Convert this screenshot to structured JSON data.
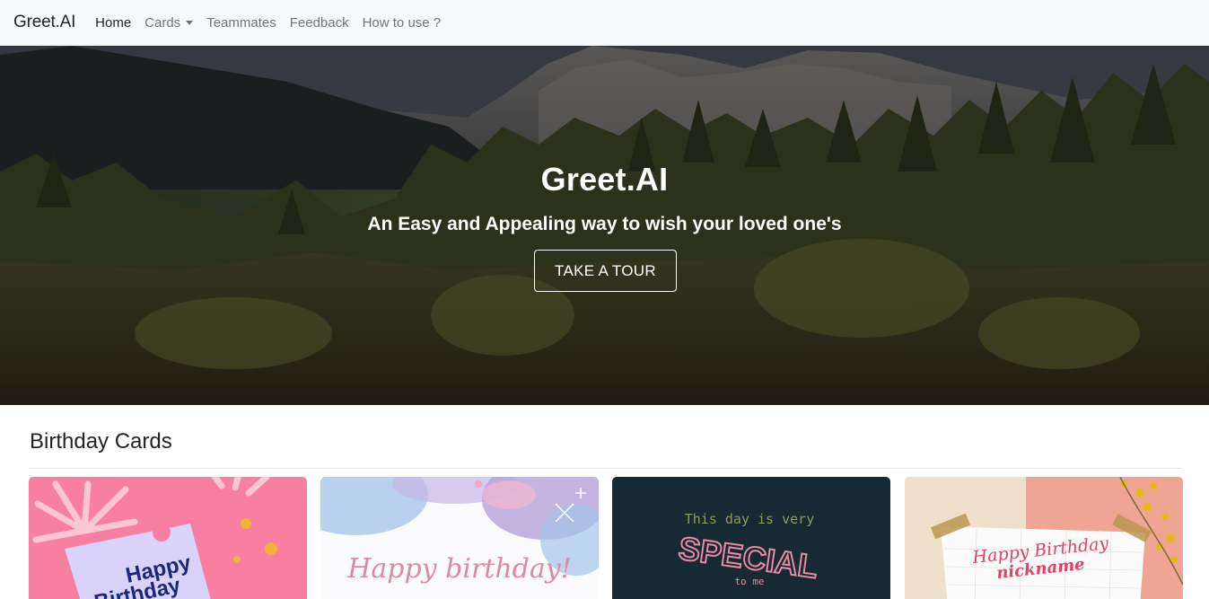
{
  "navbar": {
    "brand": "Greet.AI",
    "links": [
      {
        "label": "Home",
        "active": true
      },
      {
        "label": "Cards",
        "dropdown": true
      },
      {
        "label": "Teammates"
      },
      {
        "label": "Feedback"
      },
      {
        "label": "How to use ?"
      }
    ]
  },
  "hero": {
    "title": "Greet.AI",
    "subtitle": "An Easy and Appealing way to wish your loved one's",
    "button_label": "TAKE A TOUR"
  },
  "section": {
    "title": "Birthday Cards"
  },
  "cards": [
    {
      "text_line1": "Happy",
      "text_line2": "Birthday",
      "accent": "#f77fa2"
    },
    {
      "text": "Happy birthday!",
      "accent": "#d98aa5"
    },
    {
      "text_line1": "This day is very",
      "text_line2": "SPECIAL",
      "text_line3": "to me",
      "accent": "#172a33"
    },
    {
      "text_line1": "Happy Birthday",
      "text_line2": "nickname",
      "accent": "#e43f62"
    }
  ],
  "colors": {
    "navbar_bg": "#f8f9fa",
    "nav_muted": "#6c757d",
    "text_dark": "#212529"
  }
}
